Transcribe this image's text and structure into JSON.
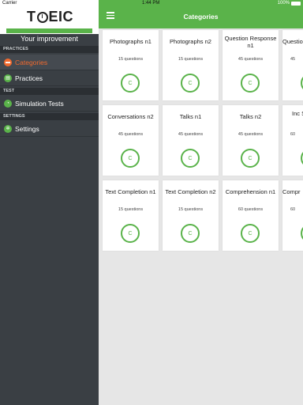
{
  "status_bar": {
    "carrier": "Carrier",
    "time": "1:44 PM",
    "battery": "100%"
  },
  "sidebar": {
    "logo": {
      "left": "T",
      "right": "EIC"
    },
    "improvement_label": "Your improvement",
    "improvement_progress": 1.0,
    "sections": [
      {
        "header": "PRACTICES",
        "items": [
          {
            "label": "Categories",
            "active": true,
            "icon": "folder-icon"
          },
          {
            "label": "Practices",
            "active": false,
            "icon": "clipboard-icon"
          }
        ]
      },
      {
        "header": "TEST",
        "items": [
          {
            "label": "Simulation Tests",
            "active": false,
            "icon": "stopwatch-icon"
          }
        ]
      },
      {
        "header": "SETTINGS",
        "items": [
          {
            "label": "Settings",
            "active": false,
            "icon": "gear-icon"
          }
        ]
      }
    ]
  },
  "topbar": {
    "title": "Categories"
  },
  "cards": [
    {
      "title": "Photographs n1",
      "count": "15 questions",
      "grade": "C"
    },
    {
      "title": "Photographs n2",
      "count": "15 questions",
      "grade": "C"
    },
    {
      "title": "Question Response n1",
      "count": "45 questions",
      "grade": "C"
    },
    {
      "title": "Question",
      "count": "45",
      "grade": "C"
    },
    {
      "title": "Conversations n2",
      "count": "45 questions",
      "grade": "C"
    },
    {
      "title": "Talks n1",
      "count": "45 questions",
      "grade": "C"
    },
    {
      "title": "Talks n2",
      "count": "45 questions",
      "grade": "C"
    },
    {
      "title": "Inc Sent",
      "count": "60",
      "grade": "C"
    },
    {
      "title": "Text Completion n1",
      "count": "15 questions",
      "grade": "C"
    },
    {
      "title": "Text Completion n2",
      "count": "15 questions",
      "grade": "C"
    },
    {
      "title": "Comprehension n1",
      "count": "60 questions",
      "grade": "C"
    },
    {
      "title": "Compr",
      "count": "60",
      "grade": "C"
    }
  ],
  "colors": {
    "accent_green": "#5ab34a",
    "active_orange": "#f26a2e",
    "sidebar_bg": "#3a3f44"
  }
}
